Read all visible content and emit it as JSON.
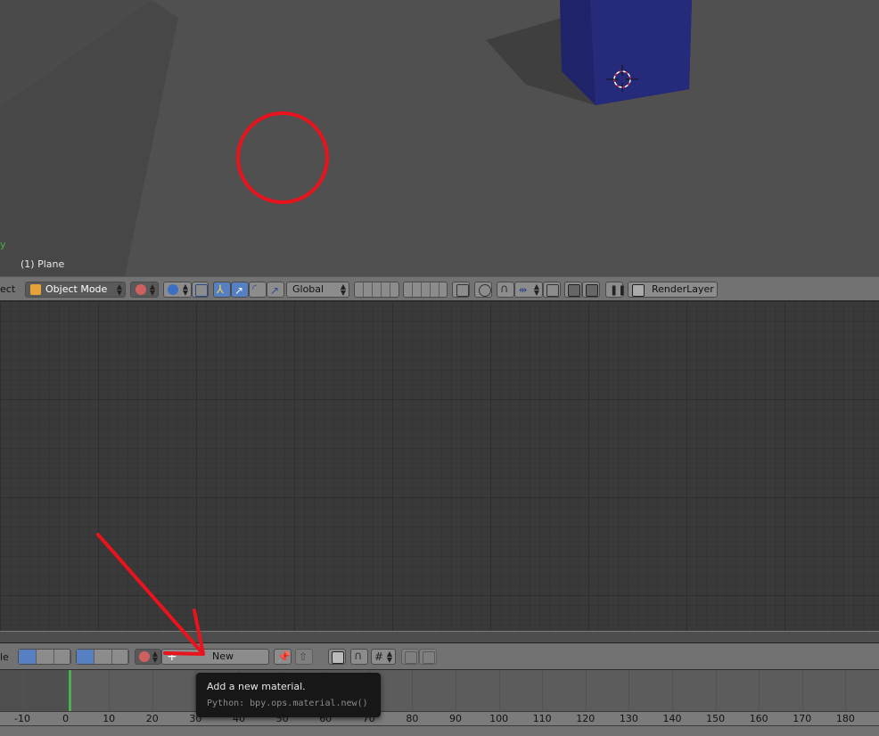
{
  "viewport": {
    "axis_label": "y",
    "object_info": "(1) Plane"
  },
  "header_3d": {
    "menu_fragment": "ect",
    "mode_label": "Object Mode",
    "orientation_label": "Global",
    "render_layer_label": "RenderLayer"
  },
  "node_header": {
    "menu_fragment": "le",
    "new_button_label": "New"
  },
  "tooltip": {
    "title": "Add a new material.",
    "python": "Python: bpy.ops.material.new()"
  },
  "timeline": {
    "ruler_labels": [
      "-10",
      "0",
      "10",
      "20",
      "30",
      "40",
      "50",
      "60",
      "70",
      "80",
      "90",
      "100",
      "110",
      "120",
      "130",
      "140",
      "150",
      "160",
      "170",
      "180"
    ],
    "current_frame_color": "#4caf50"
  },
  "colors": {
    "annotation_red": "#e8131c",
    "cube_blue": "#1f236a",
    "active_button_blue": "#5680c2"
  }
}
